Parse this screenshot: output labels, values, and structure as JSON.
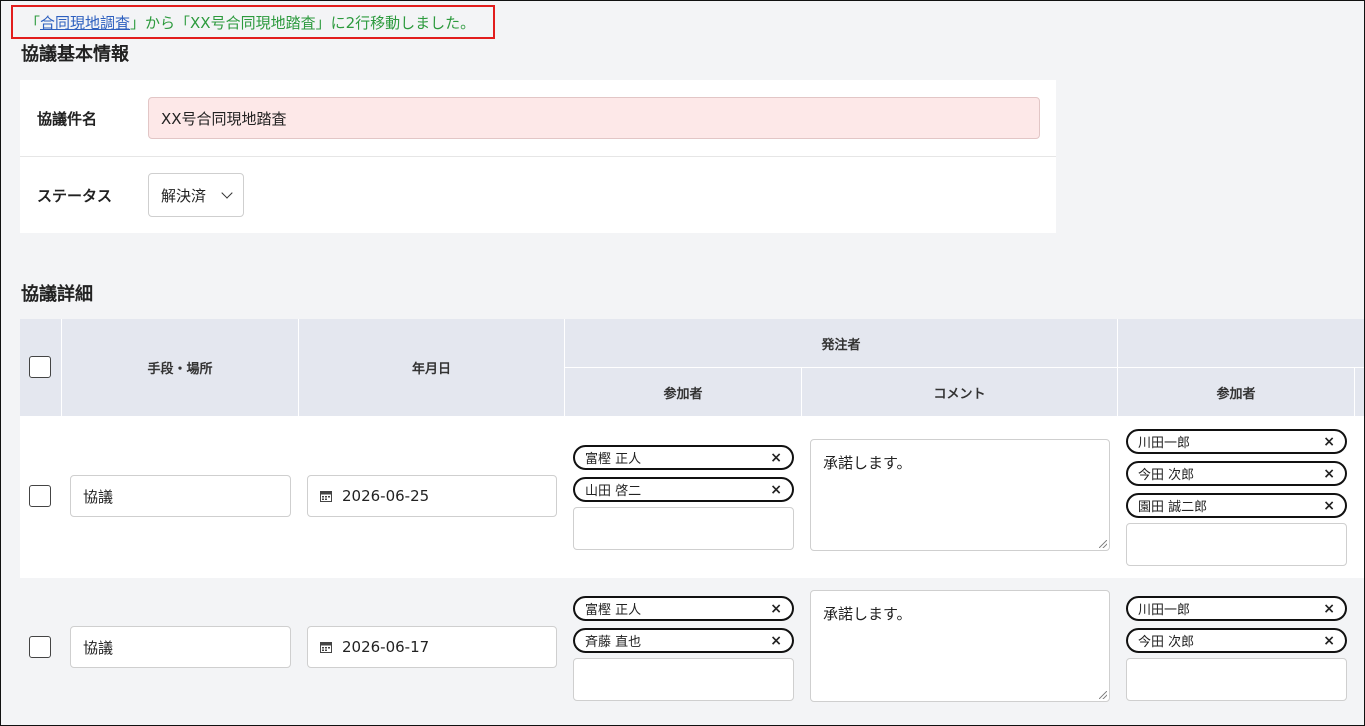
{
  "notice": {
    "prefix": "「",
    "link": "合同現地調査",
    "suffix": "」から「XX号合同現地踏査」に2行移動しました。"
  },
  "basic": {
    "title": "協議基本情報",
    "name_label": "協議件名",
    "name_value": "XX号合同現地踏査",
    "status_label": "ステータス",
    "status_value": "解決済"
  },
  "detail": {
    "title": "協議詳細",
    "headers": {
      "means": "手段・場所",
      "date": "年月日",
      "orderer": "発注者",
      "participants": "参加者",
      "comment": "コメント",
      "participants2": "参加者"
    },
    "rows": [
      {
        "means": "協議",
        "date": "2026-06-25",
        "orderer_participants": [
          "富樫 正人",
          "山田 啓二"
        ],
        "comment": "承諾します。",
        "participants2": [
          "川田一郎",
          "今田 次郎",
          "園田 誠二郎"
        ]
      },
      {
        "means": "協議",
        "date": "2026-06-17",
        "orderer_participants": [
          "富樫 正人",
          "斉藤 直也"
        ],
        "comment": "承諾します。",
        "participants2": [
          "川田一郎",
          "今田 次郎"
        ]
      }
    ],
    "remove_glyph": "×"
  }
}
